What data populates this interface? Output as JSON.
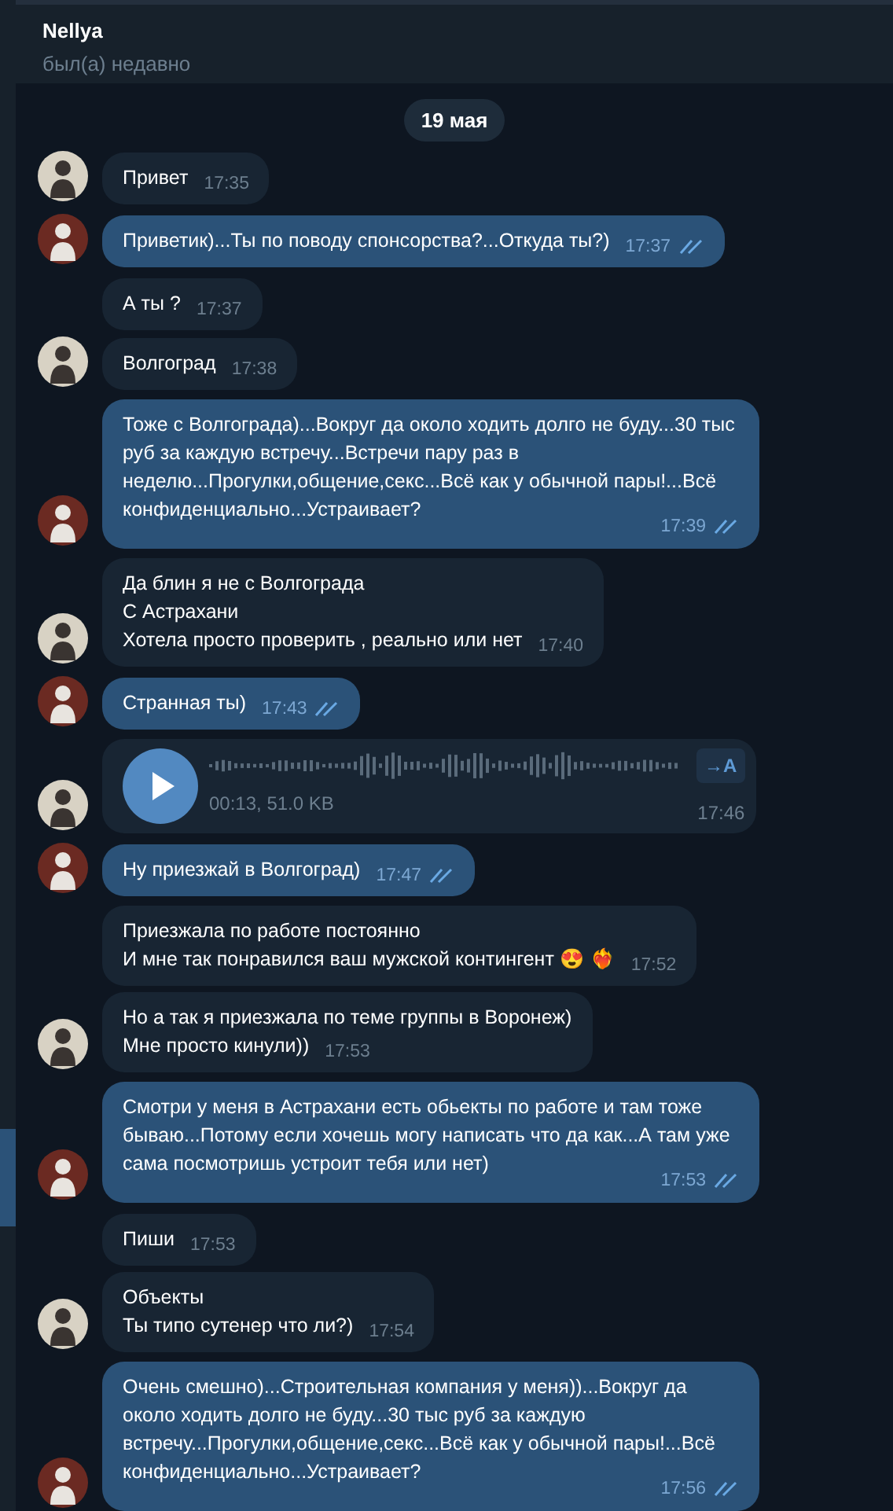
{
  "header": {
    "name": "Nellya",
    "status": "был(а) недавно"
  },
  "date": "19 мая",
  "messages": [
    {
      "kind": "text",
      "outgoing": false,
      "text": "Привет",
      "time": "17:35",
      "avatar": true
    },
    {
      "kind": "text",
      "outgoing": true,
      "text": "Приветик)...Ты по поводу спонсорства?...Откуда ты?)",
      "time": "17:37",
      "avatar": true,
      "read": true
    },
    {
      "kind": "text",
      "outgoing": false,
      "text": "А ты ?",
      "time": "17:37",
      "avatar": false
    },
    {
      "kind": "text",
      "outgoing": false,
      "text": "Волгоград",
      "time": "17:38",
      "avatar": true
    },
    {
      "kind": "text",
      "outgoing": true,
      "text": "Тоже с Волгограда)...Вокруг да около ходить долго не буду...30 тыс руб за каждую встречу...Встречи пару раз в неделю...Прогулки,общение,секс...Всё как у обычной пары!...Всё конфиденциально...Устраивает?",
      "time": "17:39",
      "avatar": true,
      "read": true
    },
    {
      "kind": "text",
      "outgoing": false,
      "text": "Да блин я не с Волгограда\nС Астрахани\nХотела просто проверить , реально или нет",
      "time": "17:40",
      "avatar": true
    },
    {
      "kind": "text",
      "outgoing": true,
      "text": "Странная ты)",
      "time": "17:43",
      "avatar": true,
      "read": true
    },
    {
      "kind": "voice",
      "outgoing": false,
      "info": "00:13, 51.0 KB",
      "transcribe": "→A",
      "time": "17:46",
      "avatar": true
    },
    {
      "kind": "text",
      "outgoing": true,
      "text": "Ну приезжай в Волгоград)",
      "time": "17:47",
      "avatar": true,
      "read": true
    },
    {
      "kind": "text",
      "outgoing": false,
      "text": "Приезжала по работе постоянно\nИ мне так понравился ваш мужской контингент 😍 ❤️‍🔥",
      "time": "17:52",
      "avatar": false
    },
    {
      "kind": "text",
      "outgoing": false,
      "text": "Но а так я приезжала по теме группы в Воронеж)\nМне просто кинули))",
      "time": "17:53",
      "avatar": true
    },
    {
      "kind": "text",
      "outgoing": true,
      "text": "Смотри у меня в Астрахани есть обьекты по работе и там тоже бываю...Потому если хочешь могу написать что да как...А там уже сама посмотришь устроит тебя или нет)",
      "time": "17:53",
      "avatar": true,
      "read": true
    },
    {
      "kind": "text",
      "outgoing": false,
      "text": "Пиши",
      "time": "17:53",
      "avatar": false
    },
    {
      "kind": "text",
      "outgoing": false,
      "text": "Объекты\nТы типо сутенер что ли?)",
      "time": "17:54",
      "avatar": true
    },
    {
      "kind": "text",
      "outgoing": true,
      "text": "Очень смешно)...Строительная компания у меня))...Вокруг да около ходить долго не буду...30 тыс руб за каждую встречу...Прогулки,общение,секс...Всё как у обычной пары!...Всё конфиденциально...Устраивает?",
      "time": "17:56",
      "avatar": true,
      "read": true
    }
  ]
}
